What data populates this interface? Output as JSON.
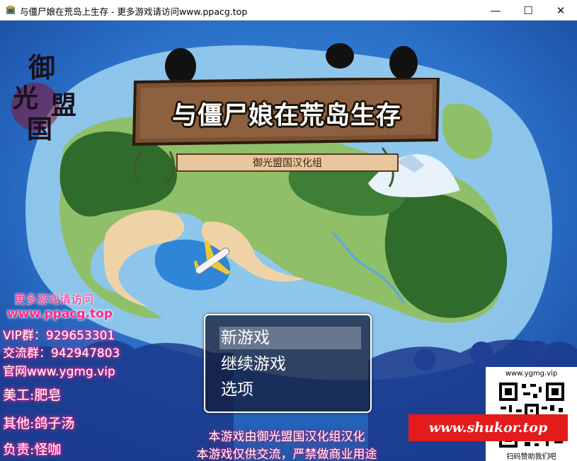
{
  "window": {
    "title": "与僵尸娘在荒岛上生存 - 更多游戏请访问www.ppacg.top",
    "minimize_glyph": "—",
    "maximize_glyph": "☐",
    "close_glyph": "✕"
  },
  "game": {
    "title": "与僵尸娘在荒岛生存",
    "subtitle": "御光盟国汉化组",
    "side_logo_chars": [
      "御",
      "光",
      "盟",
      "国"
    ],
    "menu": {
      "items": [
        {
          "label": "新游戏",
          "selected": true
        },
        {
          "label": "继续游戏",
          "selected": false
        },
        {
          "label": "选项",
          "selected": false
        }
      ]
    }
  },
  "promo": {
    "more_games": "更多游戏请访问",
    "site": "www.ppacg.top",
    "vip_group": "VIP群：929653301",
    "chat_group": "交流群：942947803",
    "official_site": "官网www.ygmg.vip",
    "art": "美工:肥皂",
    "other": "其他:鸽子汤",
    "lead": "负责:怪咖"
  },
  "credits": {
    "line1": "本游戏由御光盟国汉化组汉化",
    "line2": "本游戏仅供交流，严禁做商业用途"
  },
  "watermark": {
    "shukor": "www.shukor.top",
    "qr_url": "www.ygmg.vip",
    "qr_caption": "扫码赞助我们吧"
  },
  "colors": {
    "ocean": "#1d57b0",
    "land_light": "#8fbf68",
    "forest": "#2f6b2a",
    "promo_pink": "#ff2b8a",
    "menu_bg": "#141e3c",
    "shukor_red": "#e31b1b"
  }
}
